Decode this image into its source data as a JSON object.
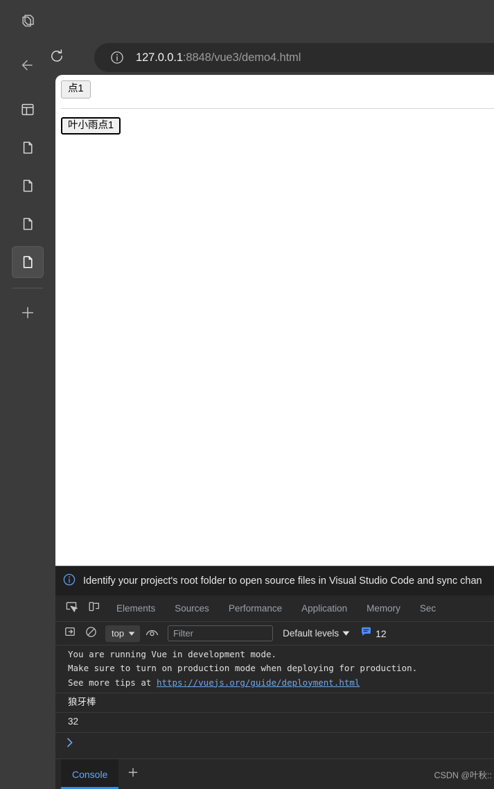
{
  "browser": {
    "sidebar": {
      "items": [
        {
          "icon": "layers-icon",
          "name": "copilot-layers"
        },
        {
          "icon": "arrow-left-icon",
          "name": "back"
        },
        {
          "icon": "browser-window-icon",
          "name": "split-screen"
        },
        {
          "icon": "document-icon",
          "name": "tab-1"
        },
        {
          "icon": "document-icon",
          "name": "tab-2"
        },
        {
          "icon": "document-icon",
          "name": "tab-3"
        },
        {
          "icon": "document-icon",
          "name": "tab-4-selected"
        },
        {
          "icon": "plus-icon",
          "name": "new-tab"
        }
      ]
    },
    "toolbar": {
      "reload_icon": "reload-icon",
      "site_info_icon": "info-circle-icon"
    },
    "omnibox": {
      "host": "127.0.0.1",
      "path": ":8848/vue3/demo4.html"
    }
  },
  "page": {
    "button_top": "点1",
    "button_bottom": "叶小雨点1"
  },
  "devtools": {
    "banner": {
      "icon": "info-circle-icon",
      "text": "Identify your project's root folder to open source files in Visual Studio Code and sync chan"
    },
    "tabs": [
      {
        "label": "Elements"
      },
      {
        "label": "Sources"
      },
      {
        "label": "Performance"
      },
      {
        "label": "Application"
      },
      {
        "label": "Memory"
      },
      {
        "label": "Sec"
      }
    ],
    "tab_icons": [
      {
        "name": "inspect-element-icon"
      },
      {
        "name": "device-toolbar-icon"
      }
    ],
    "console_toolbar": {
      "sidebar_toggle_icon": "console-sidebar-icon",
      "clear_icon": "clear-console-icon",
      "context": "top",
      "eye_icon": "live-expression-icon",
      "filter_placeholder": "Filter",
      "levels": "Default levels",
      "message_icon": "message-bubble-icon",
      "message_count": "12"
    },
    "console_log": [
      {
        "type": "mono",
        "lines": [
          "You are running Vue in development mode.",
          "Make sure to turn on production mode when deploying for production.",
          "See more tips at "
        ],
        "link": "https://vuejs.org/guide/deployment.html"
      },
      {
        "type": "plain",
        "text": "狼牙棒"
      },
      {
        "type": "plain",
        "text": "32"
      }
    ],
    "prompt_icon": "chevron-right-icon",
    "bottom": {
      "drawer_tab": "Console",
      "add_icon": "plus-icon",
      "watermark": "CSDN @叶秋::"
    }
  },
  "colors": {
    "chrome_bg": "#3b3b3b",
    "omnibox_bg": "#2b2b2b",
    "devtools_bg": "#282828",
    "banner_bg": "#1f1f1f",
    "accent_blue": "#2d8cf0",
    "link_blue": "#6aa9f0",
    "page_bg": "#ffffff"
  }
}
